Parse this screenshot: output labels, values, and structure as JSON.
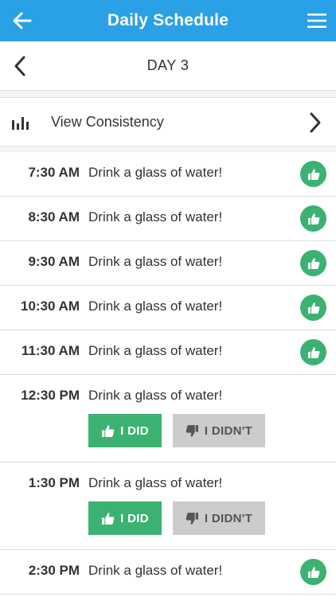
{
  "appbar": {
    "title": "Daily Schedule"
  },
  "day": {
    "label": "DAY 3"
  },
  "consistency": {
    "label": "View Consistency"
  },
  "buttons": {
    "did": "I DID",
    "didnt": "I DIDN'T"
  },
  "colors": {
    "primary": "#2aa0e6",
    "success": "#3bb273",
    "muted": "#cccccc"
  },
  "schedule": [
    {
      "time": "7:30 AM",
      "task": "Drink a glass of water!",
      "status": "done"
    },
    {
      "time": "8:30 AM",
      "task": "Drink a glass of water!",
      "status": "done"
    },
    {
      "time": "9:30 AM",
      "task": "Drink a glass of water!",
      "status": "done"
    },
    {
      "time": "10:30 AM",
      "task": "Drink a glass of water!",
      "status": "done"
    },
    {
      "time": "11:30 AM",
      "task": "Drink a glass of water!",
      "status": "done"
    },
    {
      "time": "12:30 PM",
      "task": "Drink a glass of water!",
      "status": "pending"
    },
    {
      "time": "1:30 PM",
      "task": "Drink a glass of water!",
      "status": "pending"
    },
    {
      "time": "2:30 PM",
      "task": "Drink a glass of water!",
      "status": "done"
    }
  ]
}
